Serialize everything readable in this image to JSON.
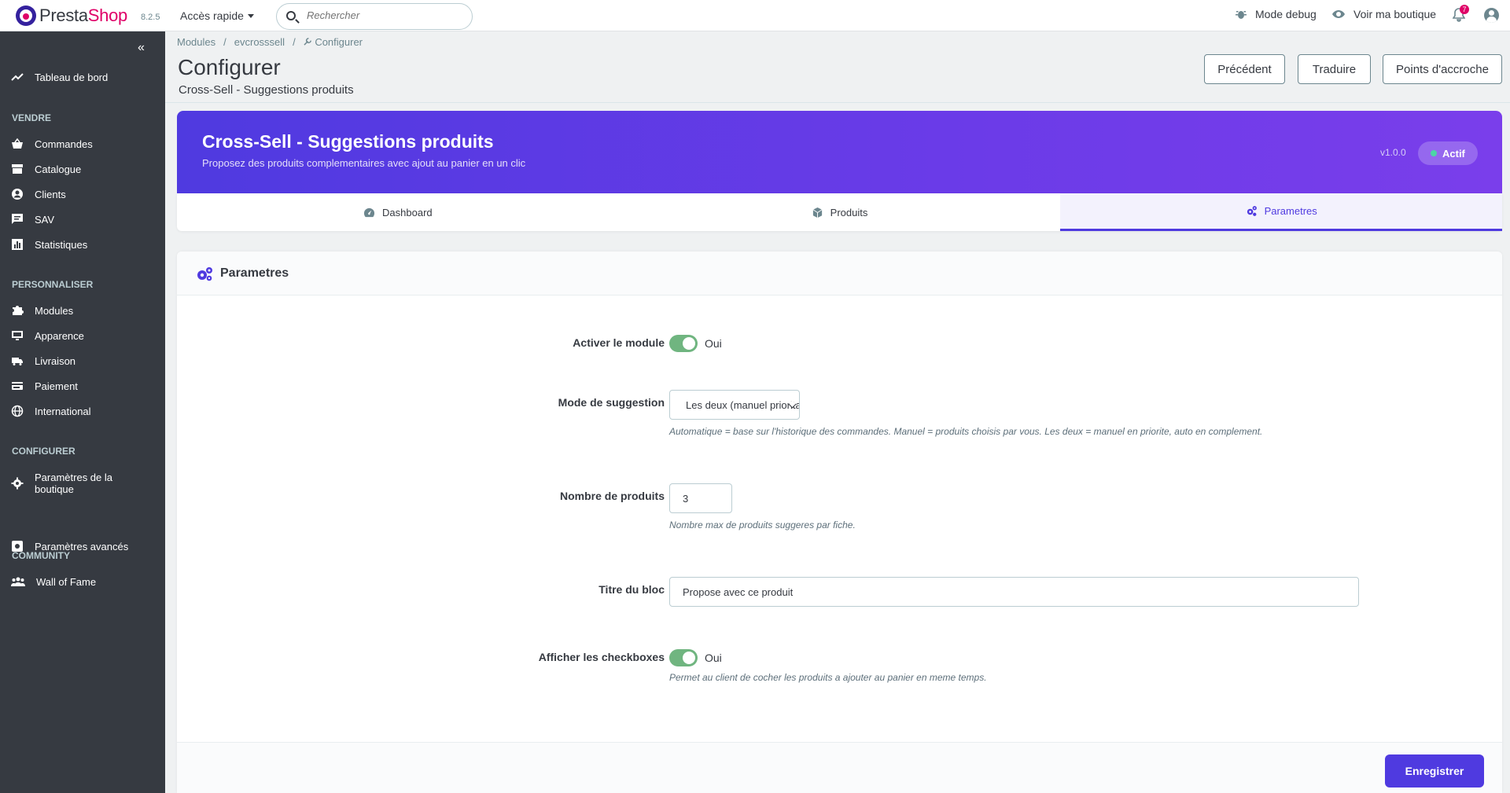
{
  "header": {
    "logo_text_a": "Presta",
    "logo_text_b": "Shop",
    "version": "8.2.5",
    "quick_access": "Accès rapide",
    "search_placeholder": "Rechercher",
    "debug": "Mode debug",
    "view_shop": "Voir ma boutique",
    "notif_count": "7"
  },
  "sidebar": {
    "collapse": "«",
    "dashboard": "Tableau de bord",
    "sections": {
      "vendre": "VENDRE",
      "personnaliser": "PERSONNALISER",
      "configurer": "CONFIGURER",
      "community": "COMMUNITY"
    },
    "items": {
      "commandes": "Commandes",
      "catalogue": "Catalogue",
      "clients": "Clients",
      "sav": "SAV",
      "statistiques": "Statistiques",
      "modules": "Modules",
      "apparence": "Apparence",
      "livraison": "Livraison",
      "paiement": "Paiement",
      "international": "International",
      "parametres_boutique_1": "Paramètres de la",
      "parametres_boutique_2": "boutique",
      "parametres_avances": "Paramètres avancés",
      "wall_of_fame": "Wall of Fame"
    }
  },
  "breadcrumb": {
    "modules": "Modules",
    "sep": "/",
    "module": "evcrosssell",
    "current": "Configurer"
  },
  "page": {
    "title": "Configurer",
    "subtitle": "Cross-Sell - Suggestions produits"
  },
  "toolbar": {
    "previous": "Précédent",
    "translate": "Traduire",
    "hooks": "Points d'accroche"
  },
  "hero": {
    "title": "Cross-Sell - Suggestions produits",
    "description": "Proposez des produits complementaires avec ajout au panier en un clic",
    "version": "v1.0.0",
    "status": "Actif"
  },
  "tabs": {
    "dashboard": "Dashboard",
    "produits": "Produits",
    "parametres": "Parametres"
  },
  "form": {
    "title": "Parametres",
    "enable_label": "Activer le module",
    "enable_value": "Oui",
    "mode_label": "Mode de suggestion",
    "mode_value": "Les deux (manuel prioritaire",
    "mode_help": "Automatique = base sur l'historique des commandes. Manuel = produits choisis par vous. Les deux = manuel en priorite, auto en complement.",
    "count_label": "Nombre de produits",
    "count_value": "3",
    "count_help": "Nombre max de produits suggeres par fiche.",
    "block_title_label": "Titre du bloc",
    "block_title_value": "Propose avec ce produit",
    "checkbox_label": "Afficher les checkboxes",
    "checkbox_value": "Oui",
    "checkbox_help": "Permet au client de cocher les produits a ajouter au panier en meme temps.",
    "save": "Enregistrer"
  },
  "colors": {
    "accent": "#4f3ae0",
    "switch_on": "#70b580",
    "sidebar_bg": "#363a41",
    "brand_pink": "#df0067"
  }
}
